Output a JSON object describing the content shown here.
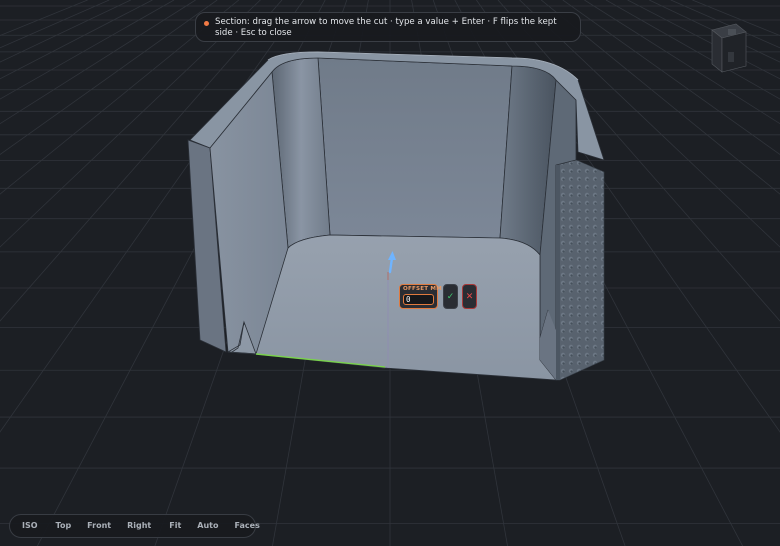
{
  "hint": {
    "text": "Section: drag the arrow to move the cut · type a value + Enter · F flips the kept side · Esc to close",
    "dot_color": "#f27a45"
  },
  "offset_panel": {
    "label": "OFFSET MM",
    "value": "0",
    "confirm_icon": "check-icon",
    "cancel_icon": "close-icon",
    "confirm_glyph": "✓",
    "cancel_glyph": "✕"
  },
  "view_toolbar": {
    "buttons": [
      "ISO",
      "Top",
      "Front",
      "Right",
      "Fit",
      "Auto",
      "Faces"
    ]
  },
  "colors": {
    "background": "#1c1f24",
    "model": "#7a8493",
    "accent": "#e07a3e",
    "confirm": "#3ec46d",
    "cancel": "#ea4a4a",
    "gizmo_arrow": "#6fb4ff"
  }
}
